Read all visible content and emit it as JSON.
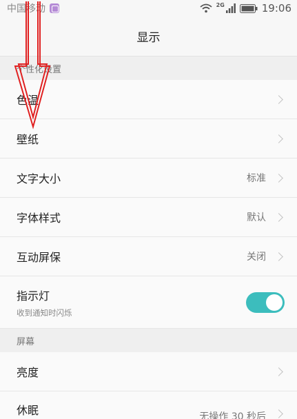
{
  "status_bar": {
    "carrier": "中国移动",
    "network_label": "2G",
    "time": "19:06"
  },
  "header": {
    "title": "显示"
  },
  "sections": [
    {
      "header": "个性化设置"
    },
    {
      "header": "屏幕"
    }
  ],
  "personalization": {
    "color_temp": {
      "label": "色温"
    },
    "wallpaper": {
      "label": "壁纸"
    },
    "font_size": {
      "label": "文字大小",
      "value": "标准"
    },
    "font_style": {
      "label": "字体样式",
      "value": "默认"
    },
    "screensaver": {
      "label": "互动屏保",
      "value": "关闭"
    },
    "indicator": {
      "label": "指示灯",
      "sub": "收到通知时闪烁",
      "enabled": true
    }
  },
  "screen": {
    "brightness": {
      "label": "亮度"
    },
    "sleep": {
      "label": "休眠",
      "value": "无操作 30 秒后"
    }
  },
  "colors": {
    "accent": "#3cbdbd",
    "annotation": "#e02020"
  }
}
